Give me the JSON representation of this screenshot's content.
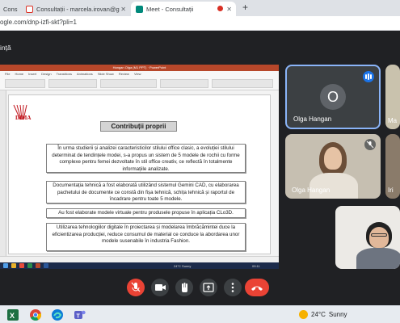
{
  "browser": {
    "tabs": [
      {
        "label": "Consultații",
        "active": false
      },
      {
        "label": "Consultații - marcela.irovan@g",
        "active": false
      },
      {
        "label": "Meet - Consultații",
        "active": true
      }
    ],
    "url": "ogle.com/dnp-izfi-skt?pli=1"
  },
  "meet": {
    "title": "ință"
  },
  "presentation": {
    "window_title": "Hangan Olga (M1 PPT) · PowerPoint",
    "ribbon_tabs": [
      "File",
      "Home",
      "Insert",
      "Design",
      "Transitions",
      "Animations",
      "Slide Show",
      "Review",
      "View"
    ],
    "slide": {
      "logo_text": "DIMA",
      "title": "Contribuții proprii",
      "paragraphs": [
        "În urma studierii și analizei caracteristicilor stilului office clasic, a evoluției stilului determinat de tendințele modei, s-a propus un sistem de 5 modele de rochii cu forme complexe pentru femei dezvoltate în stil office creativ, ce reflectă în totalmente informațiile analizate.",
        "Documentația tehnică a fost elaborată utilizând sistemul Gemini CAD, cu elaborarea pachetului de documente ce constă din fișa tehnică, schița tehnică și raportul de încadrare pentru toate 5 modele.",
        "Au fost elaborate modele virtuale pentru produsele propuse în aplicația CLo3D.",
        "Utilizarea tehnologiilor digitale în proiectarea și modelarea îmbrăcămintei duce la eficientizarea producției, reduce consumul de material ce conduce la abordarea unor modele susenabile în industria Fashion."
      ]
    },
    "inner_taskbar": {
      "weather": "24°C Sunny",
      "time": "09:11"
    }
  },
  "participants": [
    {
      "name": "Olga Hangan",
      "avatar_letter": "O",
      "speaking": true
    },
    {
      "name": "Ma",
      "avatar_letter": ""
    },
    {
      "name": "Olga Hangan",
      "muted": true
    },
    {
      "name": "Iri"
    },
    {
      "name": ""
    },
    {
      "name": ""
    }
  ],
  "controls": [
    "mic-off",
    "camera",
    "raise-hand",
    "present",
    "more-options",
    "leave-call"
  ],
  "colors": {
    "meet_bg": "#202124",
    "control_bg": "#3c4043",
    "leave_red": "#ea4335",
    "speaking_border": "#8ab4f8",
    "accent_blue": "#1a73e8"
  },
  "taskbar": {
    "weather_temp": "24°C",
    "weather_text": "Sunny",
    "apps": [
      "excel",
      "chrome",
      "edge",
      "teams"
    ]
  }
}
